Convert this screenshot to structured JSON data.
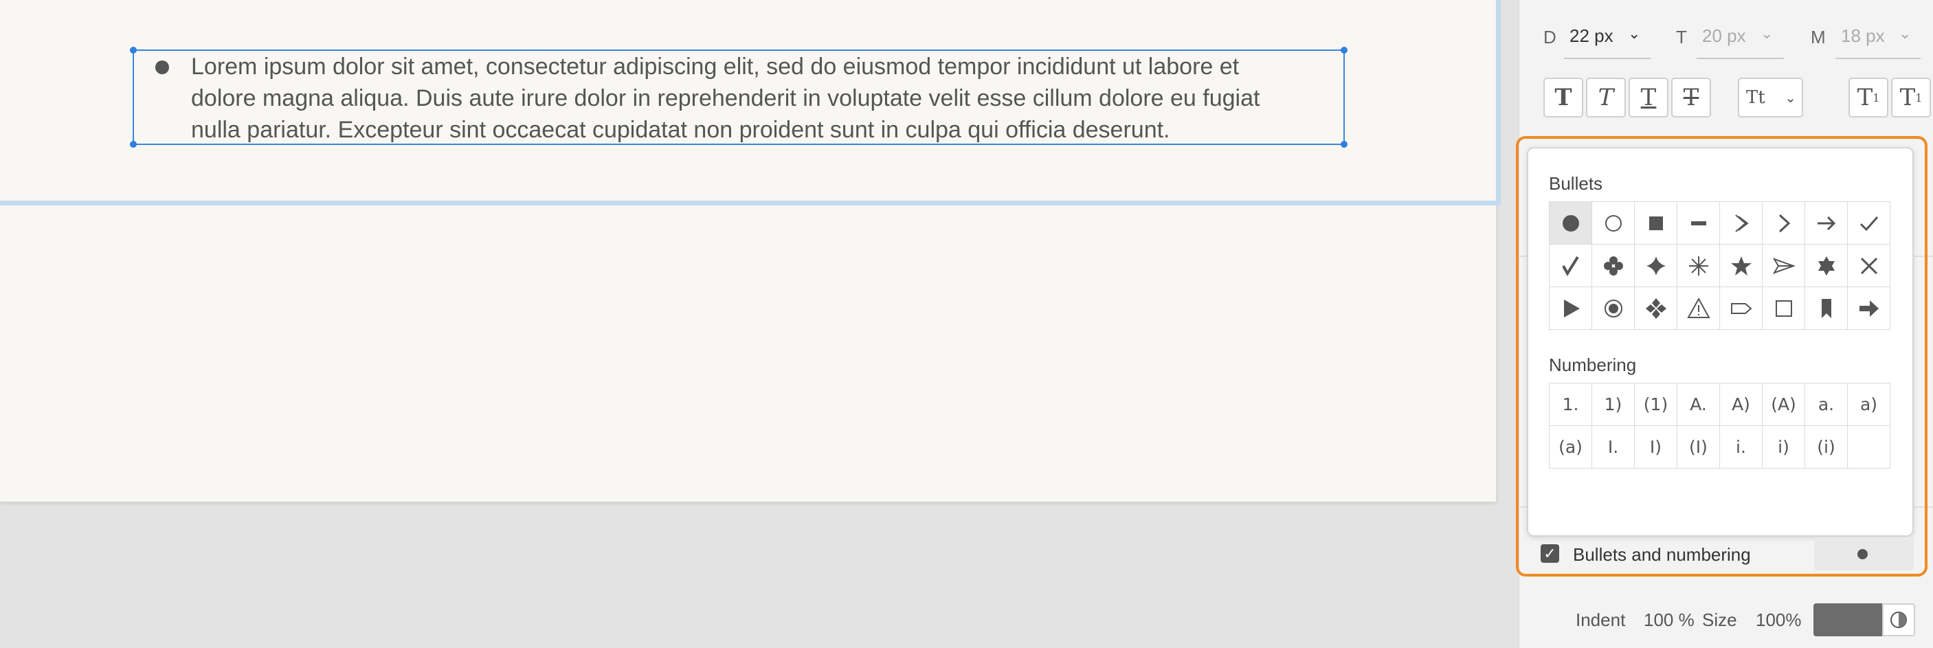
{
  "document": {
    "lines": [
      "Lorem ipsum dolor sit amet, consectetur adipiscing elit, sed do eiusmod tempor incididunt ut labore et",
      "dolore magna aliqua. Duis aute irure dolor in reprehenderit in voluptate velit esse cillum dolore eu fugiat",
      "nulla pariatur. Excepteur sint occaecat cupidatat non proident sunt in culpa qui officia deserunt."
    ]
  },
  "panel": {
    "sizes": [
      {
        "label": "D",
        "value": "22 px"
      },
      {
        "label": "T",
        "value": "20 px"
      },
      {
        "label": "M",
        "value": "18 px"
      }
    ],
    "format_buttons": [
      "bold-icon",
      "italic-icon",
      "underline-icon",
      "strikethrough-icon",
      "text-case-icon",
      "superscript-icon",
      "subscript-icon"
    ],
    "bullets_label": "Bullets",
    "numbering_label": "Numbering",
    "bullets": [
      "filled-circle",
      "hollow-circle",
      "filled-square",
      "dash",
      "double-chevron",
      "chevron",
      "arrow",
      "check",
      "check-alt",
      "clover",
      "diamond",
      "asterisk",
      "star",
      "paper-plane",
      "star-of-david",
      "x-mark",
      "triangle-right",
      "target",
      "four-diamonds",
      "warning",
      "tag",
      "hollow-square",
      "bookmark",
      "bold-arrow"
    ],
    "numbering": [
      "1.",
      "1)",
      "(1)",
      "A.",
      "A)",
      "(A)",
      "a.",
      "a)",
      "(a)",
      "I.",
      "I)",
      "(I)",
      "i.",
      "i)",
      "(i)",
      ""
    ],
    "bullets_and_numbering_label": "Bullets and numbering",
    "bullets_and_numbering_checked": true,
    "indent_label": "Indent",
    "indent_value": "100 %",
    "size_label": "Size",
    "size_value": "100%",
    "highlight_color": "#f08a24"
  }
}
